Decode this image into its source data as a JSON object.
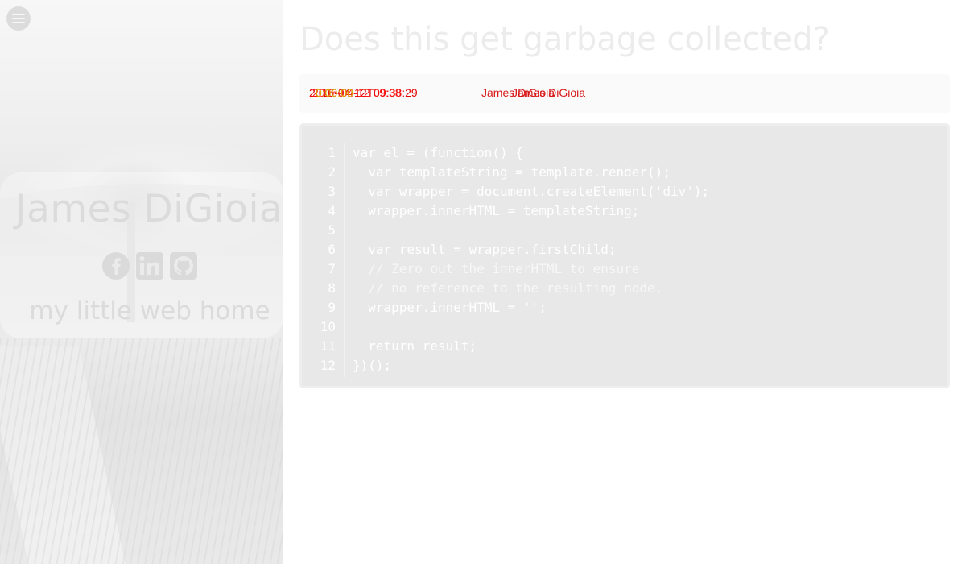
{
  "sidebar": {
    "menu_icon": "hamburger-menu-icon",
    "profile": {
      "name": "James DiGioia",
      "tagline": "my little web home",
      "social": [
        {
          "name": "Facebook",
          "icon": "facebook-icon"
        },
        {
          "name": "LinkedIn",
          "icon": "linkedin-icon"
        },
        {
          "name": "GitHub",
          "icon": "github-icon"
        }
      ]
    }
  },
  "post": {
    "title": "Does this get garbage collected?",
    "meta": {
      "date": "2016-04-12T09:38:29",
      "overlap_red": "2016-04-12 09:38:",
      "overlap_yellow": "0:00:00",
      "author": "James DiGioia",
      "author_echo": "James DiGioia"
    },
    "code": {
      "line_numbers": [
        "1",
        "2",
        "3",
        "4",
        "5",
        "6",
        "7",
        "8",
        "9",
        "10",
        "11",
        "12"
      ],
      "lines": [
        "var el = (function() {",
        "  var templateString = template.render();",
        "  var wrapper = document.createElement('div');",
        "  wrapper.innerHTML = templateString;",
        "",
        "  var result = wrapper.firstChild;",
        "  // Zero out the innerHTML to ensure",
        "  // no reference to the resulting node.",
        "  wrapper.innerHTML = '';",
        "",
        "  return result;",
        "})();"
      ]
    }
  },
  "colors": {
    "meta_red": "#e60000",
    "meta_yellow": "#d8a800",
    "code_bg": "#e8e8e8"
  }
}
